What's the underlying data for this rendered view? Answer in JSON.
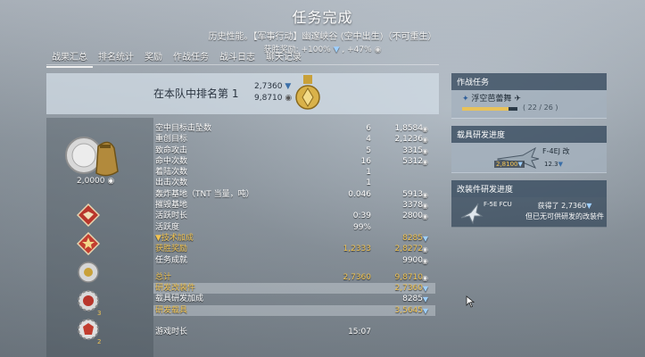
{
  "header": {
    "title": "任务完成",
    "subtitle": "历史性能。【军事行动】幽邃峡谷 (空中出生)（不可重生）",
    "reward_prefix": "获胜奖励: +100%",
    "reward_suffix": ", +47%"
  },
  "tabs": [
    {
      "label": "战果汇总",
      "active": true
    },
    {
      "label": "排名统计"
    },
    {
      "label": "奖励"
    },
    {
      "label": "作战任务"
    },
    {
      "label": "战斗日志"
    },
    {
      "label": "聊天记录"
    }
  ],
  "rank": {
    "label": "在本队中排名第 1",
    "value1": "2,7360",
    "value2": "9,8710"
  },
  "coins_value": "2,0000",
  "stats": [
    {
      "label": "空中目标击坠数",
      "count": "6",
      "value": "1,8584",
      "icon": "silver"
    },
    {
      "label": "重创目标",
      "count": "4",
      "value": "2,1236",
      "icon": "silver"
    },
    {
      "label": "致命攻击",
      "count": "5",
      "value": "3315",
      "icon": "silver"
    },
    {
      "label": "命中次数",
      "count": "16",
      "value": "5312",
      "icon": "silver"
    },
    {
      "label": "着陆次数",
      "count": "1",
      "value": "",
      "icon": ""
    },
    {
      "label": "出击次数",
      "count": "1",
      "value": "",
      "icon": ""
    },
    {
      "label": "轰炸基地（TNT 当量，吨）",
      "count": "0.046",
      "value": "5913",
      "icon": "silver"
    },
    {
      "label": "摧毁基地",
      "count": "",
      "value": "3378",
      "icon": "silver"
    },
    {
      "label": "活跃时长",
      "count": "0:39",
      "value": "2800",
      "icon": "silver"
    },
    {
      "label": "活跃度",
      "count": "99%",
      "value": "",
      "icon": ""
    },
    {
      "label": "▼技术加成",
      "count": "",
      "value": "8285",
      "icon": "rp",
      "gold": true
    },
    {
      "label": "获胜奖励",
      "count": "1,2333",
      "value": "2,8272",
      "icon": "silver",
      "gold": true
    },
    {
      "label": "任务成就",
      "count": "",
      "value": "9900",
      "icon": "silver"
    }
  ],
  "totals": [
    {
      "label": "总计",
      "count": "2,7360",
      "value": "9,8710",
      "icon": "silver",
      "gold": true,
      "highlight": false
    },
    {
      "label": "研发改装件",
      "count": "",
      "value": "2,7360",
      "icon": "rp",
      "gold": true,
      "highlight": true
    },
    {
      "label": "载具研发加成",
      "count": "",
      "value": "8285",
      "icon": "rp",
      "gold": false,
      "highlight": false
    },
    {
      "label": "研发载具",
      "count": "",
      "value": "3,5645",
      "icon": "rp",
      "gold": true,
      "highlight": true
    }
  ],
  "play_time": {
    "label": "游戏时长",
    "value": "15:07"
  },
  "side": {
    "mission": {
      "header": "作战任务",
      "name": "浮空芭蕾舞",
      "progress_text": "( 22 / 26 )",
      "progress": 0.846
    },
    "vehicle": {
      "header": "载具研发进度",
      "name": "F-4EJ 改",
      "rp": "2,8100",
      "bonus": "12.3"
    },
    "mod": {
      "header": "改装件研发进度",
      "name": "F-5E FCU",
      "line1": "获得了 2,7360",
      "line2": "但已无可供研发的改装件"
    }
  },
  "colors": {
    "gold": "#f1c453",
    "rp": "#9fd0ff",
    "panel": "#d2dce6"
  }
}
